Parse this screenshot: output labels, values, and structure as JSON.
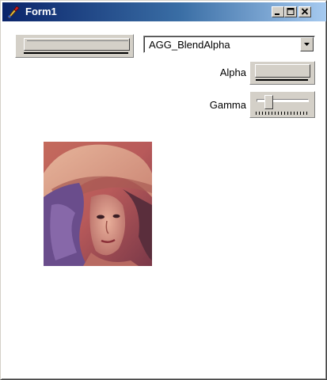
{
  "window": {
    "title": "Form1",
    "icons": {
      "app": "app-icon",
      "minimize": "minimize-icon",
      "maximize": "maximize-icon",
      "close": "close-icon"
    }
  },
  "controls": {
    "top_trackbar": {
      "position_fraction": 0.0
    },
    "combo": {
      "selected": "AGG_BlendAlpha",
      "icon": "chevron-down-icon"
    },
    "alpha": {
      "label": "Alpha",
      "position_fraction": 1.0
    },
    "gamma": {
      "label": "Gamma",
      "position_fraction": 0.1
    }
  },
  "image": {
    "subject": "portrait photo"
  }
}
